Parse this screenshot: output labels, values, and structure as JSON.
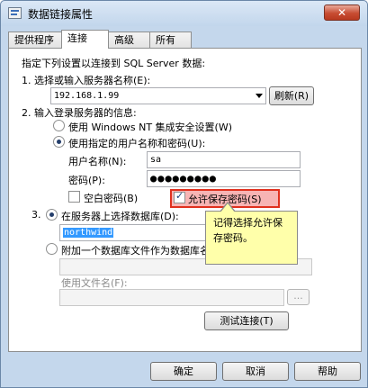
{
  "window": {
    "title": "数据链接属性",
    "close_label": "✕"
  },
  "tabs": [
    {
      "label": "提供程序"
    },
    {
      "label": "连接"
    },
    {
      "label": "高级"
    },
    {
      "label": "所有"
    }
  ],
  "intro": "指定下列设置以连接到 SQL Server 数据:",
  "step1": {
    "label": "1. 选择或输入服务器名称(E):",
    "server_value": "192.168.1.99",
    "refresh_label": "刷新(R)"
  },
  "step2": {
    "label": "2. 输入登录服务器的信息:",
    "windows_nt_label": "使用 Windows NT 集成安全设置(W)",
    "specific_user_label": "使用指定的用户名称和密码(U):",
    "username_label": "用户名称(N):",
    "username_value": "sa",
    "password_label": "密码(P):",
    "password_value": "●●●●●●●●●",
    "blank_password_label": "空白密码(B)",
    "allow_save_label": "允许保存密码(S)"
  },
  "step3": {
    "number": "3.",
    "select_db_label": "在服务器上选择数据库(D):",
    "db_value": "northwind",
    "attach_label": "附加一个数据库文件作为数据库名(H):",
    "attach_value": "",
    "filename_label": "使用文件名(F):",
    "filename_value": "",
    "browse_label": "..."
  },
  "test_button_label": "测试连接(T)",
  "callout_text": "记得选择允许保存密码。",
  "footer": {
    "ok_label": "确定",
    "cancel_label": "取消",
    "help_label": "帮助"
  }
}
